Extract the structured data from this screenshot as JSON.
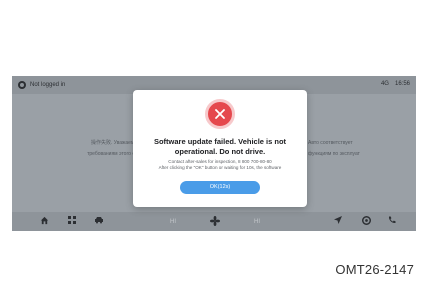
{
  "status_bar": {
    "login_status": "Not logged in",
    "signal": "4G",
    "time": "16:56"
  },
  "background": {
    "left_lines": [
      "操作失败. Уважаемы",
      "требованиям этого об"
    ],
    "right_lines": [
      "Авто соответствует",
      "функциям по эксплуат"
    ]
  },
  "modal": {
    "icon": "close-icon",
    "title": "Software update failed. Vehicle is not operational. Do not drive.",
    "body_lines": [
      "Contact after-sales for inspection, 8 800 700-80-80",
      "After clicking the \"OK\" button or waiting for 10s, the software"
    ],
    "ok_label": "OK(12s)"
  },
  "dock": {
    "items": [
      "home-icon",
      "apps-icon",
      "car-icon",
      "fan-icon",
      "navigation-icon",
      "media-icon",
      "phone-icon"
    ],
    "temp_left": "HI",
    "temp_right": "HI"
  },
  "caption": "OMT26-2147",
  "colors": {
    "screen_bg": "#9aa0a6",
    "error_red": "#e5484d",
    "ok_blue": "#4a9ce8"
  }
}
